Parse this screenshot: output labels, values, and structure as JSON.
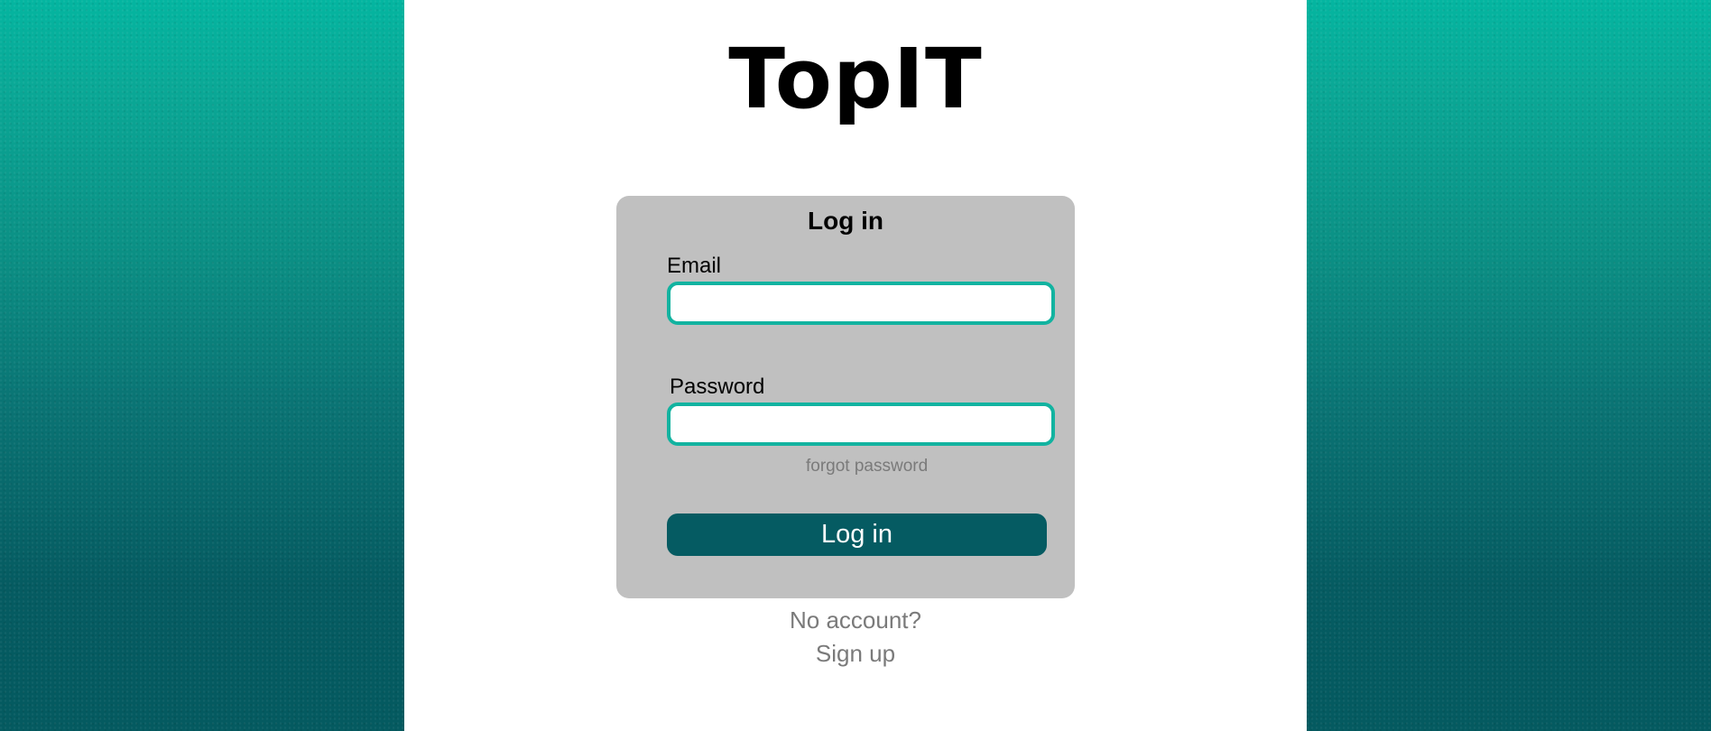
{
  "logo": {
    "text": "TopIT"
  },
  "login_card": {
    "title": "Log in",
    "email": {
      "label": "Email",
      "value": "",
      "placeholder": ""
    },
    "password": {
      "label": "Password",
      "value": "",
      "placeholder": ""
    },
    "forgot_password": "forgot password",
    "submit_label": "Log in"
  },
  "footer": {
    "no_account": "No account?",
    "sign_up": "Sign up"
  },
  "colors": {
    "accent_teal": "#12b3a0",
    "button_dark_teal": "#055b62",
    "card_gray": "#c0c0c0",
    "muted_text": "#7a7a7a"
  }
}
